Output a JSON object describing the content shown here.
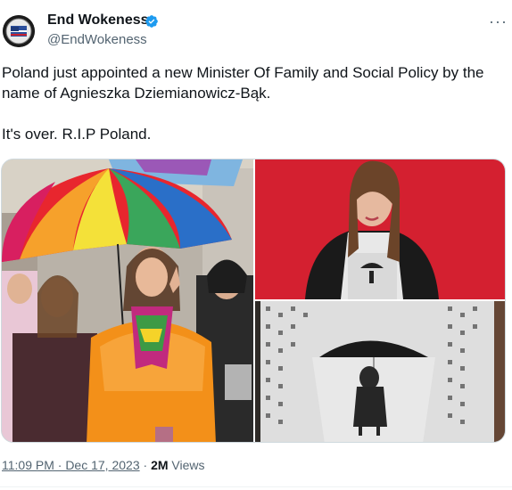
{
  "author": {
    "name": "End Wokeness",
    "handle": "@EndWokeness",
    "verified_icon": "verified-badge-icon",
    "avatar_icon": "avatar-badge-icon"
  },
  "tweet": {
    "line1": "Poland just appointed a new Minister Of Family and Social Policy by the name of Agnieszka Dziemianowicz-Bąk.",
    "line2": "It's over. R.I.P Poland."
  },
  "meta": {
    "timestamp": "11:09 PM · Dec 17, 2023",
    "separator": "·",
    "views_count": "2M",
    "views_label": "Views"
  },
  "more_icon": "more-options-icon",
  "colors": {
    "text": "#0f1419",
    "secondary": "#536471",
    "verified": "#1d9bf0",
    "photo_red": "#d42030",
    "orange_jacket": "#f39019"
  }
}
